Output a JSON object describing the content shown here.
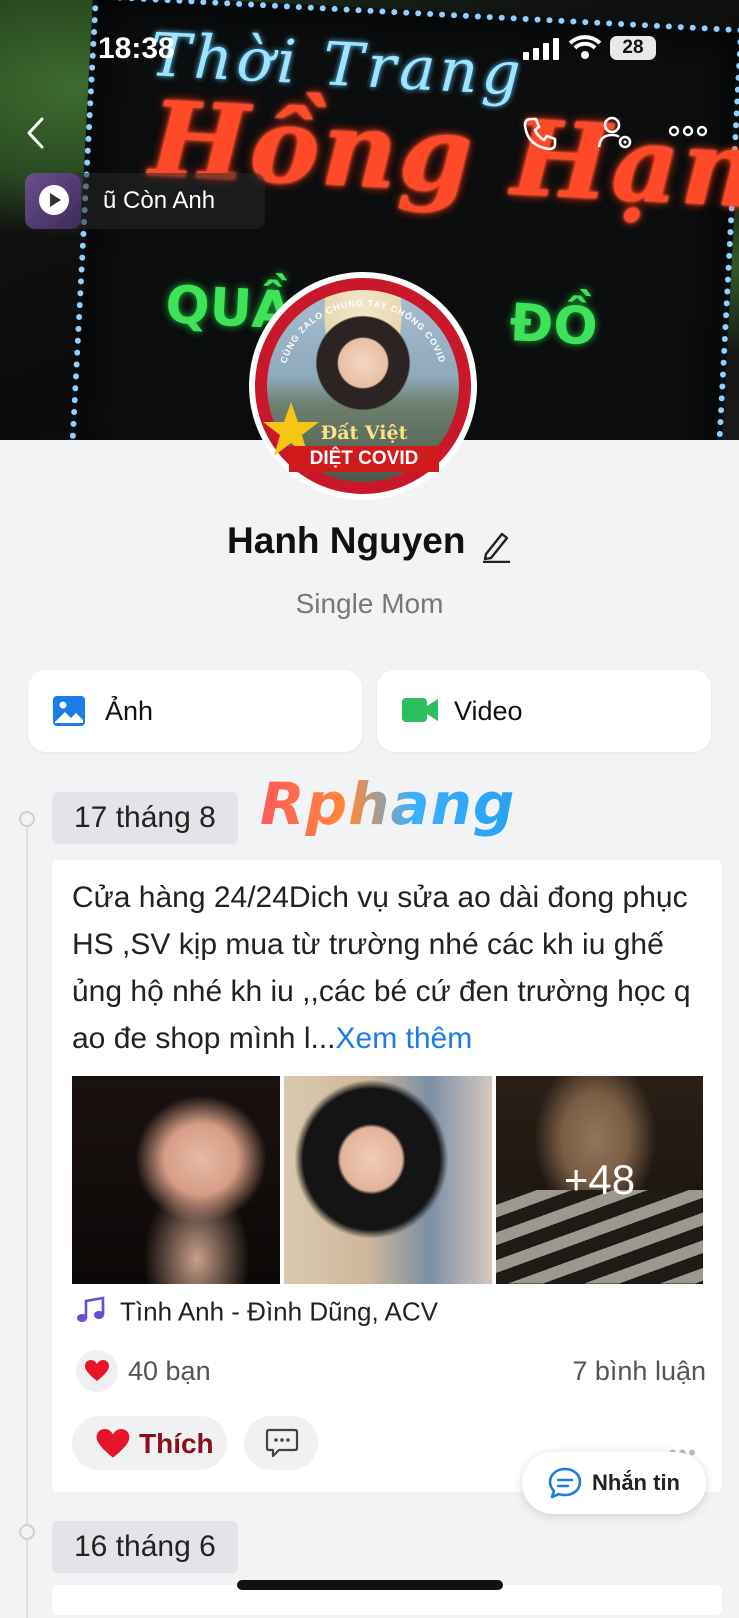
{
  "status_bar": {
    "time": "18:38",
    "battery": "28"
  },
  "cover": {
    "sign_line1": "Thời Trang",
    "sign_line2": "Hồng Hạnh",
    "sign_line3": "QUẦ  ĐỒ LÓT"
  },
  "music_chip": {
    "text": "ũ Còn Anh"
  },
  "avatar": {
    "frame_top_text": "CÙNG ZALO CHUNG TAY CHỐNG COVID",
    "frame_line1": "Đất Việt",
    "frame_line2": "DIỆT COVID"
  },
  "profile": {
    "name": "Hanh Nguyen",
    "bio": "Single Mom"
  },
  "actions": {
    "photo_label": "Ảnh",
    "video_label": "Video"
  },
  "watermark": "Rphang",
  "timeline": [
    {
      "date": "17 tháng 8",
      "text": "Cửa hàng 24/24Dich vụ sửa ao dài đong phục HS ,SV kịp mua từ trường nhé các kh iu  ghế ủng hộ nhé kh iu ,,các bé cứ đen trường học q ao đe shop mình l...",
      "see_more": "Xem thêm",
      "extra_photos": "+48",
      "song": "Tình Anh - Đình Dũng, ACV",
      "likes": "40 bạn",
      "comments": "7 bình luận",
      "like_button": "Thích"
    },
    {
      "date": "16 tháng 6"
    }
  ],
  "chat_button": {
    "label": "Nhắn tin"
  },
  "colors": {
    "accent_blue": "#1a7ce6",
    "video_green": "#2dbe60",
    "heart_red": "#e8142c"
  }
}
